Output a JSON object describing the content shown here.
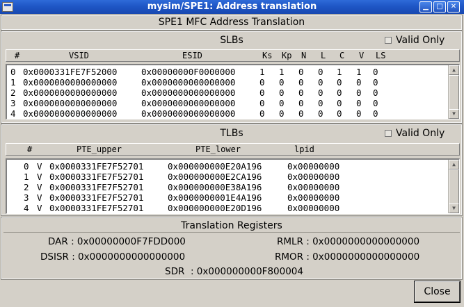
{
  "window": {
    "title": "mysim/SPE1: Address translation"
  },
  "main_title": "SPE1 MFC Address Translation",
  "slbs": {
    "section_label": "SLBs",
    "valid_only_label": "Valid Only",
    "columns": [
      "#",
      "VSID",
      "ESID",
      "Ks",
      "Kp",
      "N",
      "L",
      "C",
      "V",
      "LS"
    ],
    "rows": [
      [
        "0",
        "0x0000331FE7F52000",
        "0x00000000F0000000",
        "1",
        "1",
        "0",
        "0",
        "1",
        "1",
        "0"
      ],
      [
        "1",
        "0x0000000000000000",
        "0x0000000000000000",
        "0",
        "0",
        "0",
        "0",
        "0",
        "0",
        "0"
      ],
      [
        "2",
        "0x0000000000000000",
        "0x0000000000000000",
        "0",
        "0",
        "0",
        "0",
        "0",
        "0",
        "0"
      ],
      [
        "3",
        "0x0000000000000000",
        "0x0000000000000000",
        "0",
        "0",
        "0",
        "0",
        "0",
        "0",
        "0"
      ],
      [
        "4",
        "0x0000000000000000",
        "0x0000000000000000",
        "0",
        "0",
        "0",
        "0",
        "0",
        "0",
        "0"
      ]
    ]
  },
  "tlbs": {
    "section_label": "TLBs",
    "valid_only_label": "Valid Only",
    "columns": [
      "#",
      "PTE_upper",
      "PTE_lower",
      "lpid"
    ],
    "rows": [
      [
        "0",
        "V",
        "0x0000331FE7F52701",
        "0x000000000E20A196",
        "0x00000000"
      ],
      [
        "1",
        "V",
        "0x0000331FE7F52701",
        "0x000000000E2CA196",
        "0x00000000"
      ],
      [
        "2",
        "V",
        "0x0000331FE7F52701",
        "0x000000000E38A196",
        "0x00000000"
      ],
      [
        "3",
        "V",
        "0x0000331FE7F52701",
        "0x0000000001E4A196",
        "0x00000000"
      ],
      [
        "4",
        "V",
        "0x0000331FE7F52701",
        "0x000000000E20D196",
        "0x00000000"
      ]
    ]
  },
  "registers": {
    "section_label": "Translation Registers",
    "dar": {
      "label": "DAR",
      "value": ": 0x00000000F7FDD000"
    },
    "dsisr": {
      "label": "DSISR",
      "value": ": 0x0000000000000000"
    },
    "rmlr": {
      "label": "RMLR",
      "value": ": 0x0000000000000000"
    },
    "rmor": {
      "label": "RMOR",
      "value": ": 0x0000000000000000"
    },
    "sdr": {
      "label": "SDR",
      "value": ": 0x000000000F800004"
    }
  },
  "close_label": "Close",
  "icons": [
    "app-icon",
    "minimize-icon",
    "maximize-icon",
    "close-icon",
    "scroll-up-arrow-icon",
    "scroll-down-arrow-icon"
  ]
}
